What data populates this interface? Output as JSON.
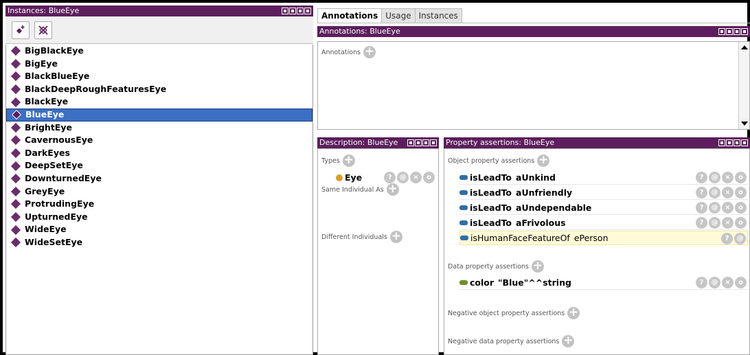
{
  "instances": {
    "title": "Instances: BlueEye",
    "items": [
      "BigBlackEye",
      "BigEye",
      "BlackBlueEye",
      "BlackDeepRoughFeaturesEye",
      "BlackEye",
      "BlueEye",
      "BrightEye",
      "CavernousEye",
      "DarkEyes",
      "DeepSetEye",
      "DownturnedEye",
      "GreyEye",
      "ProtrudingEye",
      "UpturnedEye",
      "WideEye",
      "WideSetEye"
    ],
    "selected": "BlueEye"
  },
  "tabs": [
    {
      "label": "Annotations",
      "active": true
    },
    {
      "label": "Usage",
      "active": false
    },
    {
      "label": "Instances",
      "active": false
    }
  ],
  "annotations": {
    "title": "Annotations: BlueEye",
    "section_label": "Annotations"
  },
  "description": {
    "title": "Description: BlueEye",
    "types_label": "Types",
    "type_value": "Eye",
    "same_label": "Same Individual As",
    "different_label": "Different Individuals"
  },
  "properties": {
    "title": "Property assertions: BlueEye",
    "object_label": "Object property assertions",
    "object_rows": [
      {
        "prop": "isLeadTo",
        "value": "aUnkind"
      },
      {
        "prop": "isLeadTo",
        "value": "aUnfriendly"
      },
      {
        "prop": "isLeadTo",
        "value": "aUndependable"
      },
      {
        "prop": "isLeadTo",
        "value": "aFrivolous"
      },
      {
        "prop": "isHumanFaceFeatureOf",
        "value": "ePerson"
      }
    ],
    "data_label": "Data property assertions",
    "data_rows": [
      {
        "prop": "color",
        "value": "\"Blue\"^^string"
      }
    ],
    "neg_object_label": "Negative object property assertions",
    "neg_data_label": "Negative data property assertions"
  },
  "row_button_glyphs": {
    "info": "?",
    "annotate": "@",
    "delete": "×",
    "edit": "o"
  },
  "colors": {
    "title_bar": "#5c1e5c",
    "selection": "#3a6fc4",
    "object_property": "#2f6fa8",
    "data_property": "#6f8f2a",
    "class_dot": "#d9a020",
    "highlight_row": "#fffbd6"
  }
}
